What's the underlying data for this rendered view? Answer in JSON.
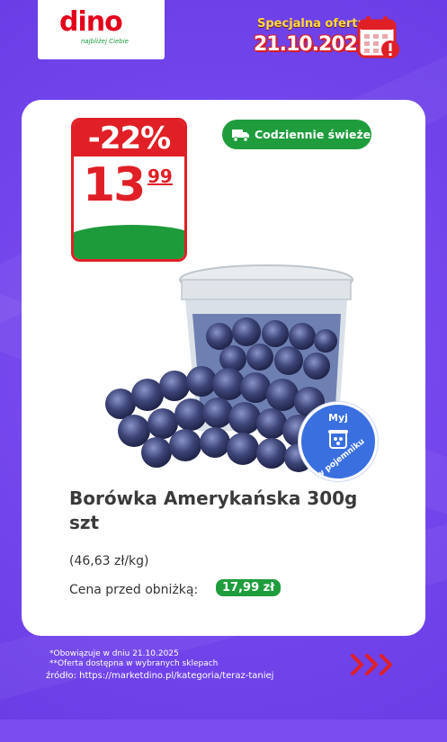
{
  "brand": {
    "logo_text": "dino",
    "tagline": "najbliżej Ciebie",
    "colors": {
      "red": "#e01f26",
      "green": "#1f9d3d",
      "purple": "#7648ee"
    }
  },
  "header": {
    "offer_label": "Specjalna oferta",
    "offer_date": "21.10.2025",
    "calendar_icon": "calendar-alert-icon"
  },
  "product": {
    "discount": "-22%",
    "price_main": "13",
    "price_cents": "99",
    "fresh_badge": "Codziennie świeże",
    "wash_badge_top": "Myj",
    "wash_badge_bottom": "w pojemniku",
    "name": "Borówka Amerykańska 300g szt",
    "price_per_kg": "(46,63 zł/kg)",
    "previous_price_label": "Cena przed obniżką:",
    "previous_price": "17,99 zł"
  },
  "footer": {
    "note1": "*Obowiązuje w dniu 21.10.2025",
    "note2": "**Oferta dostępna w wybranych sklepach",
    "source": "źródło: https://marketdino.pl/kategoria/teraz-taniej",
    "arrows_icon": "triple-chevron-right-icon"
  }
}
